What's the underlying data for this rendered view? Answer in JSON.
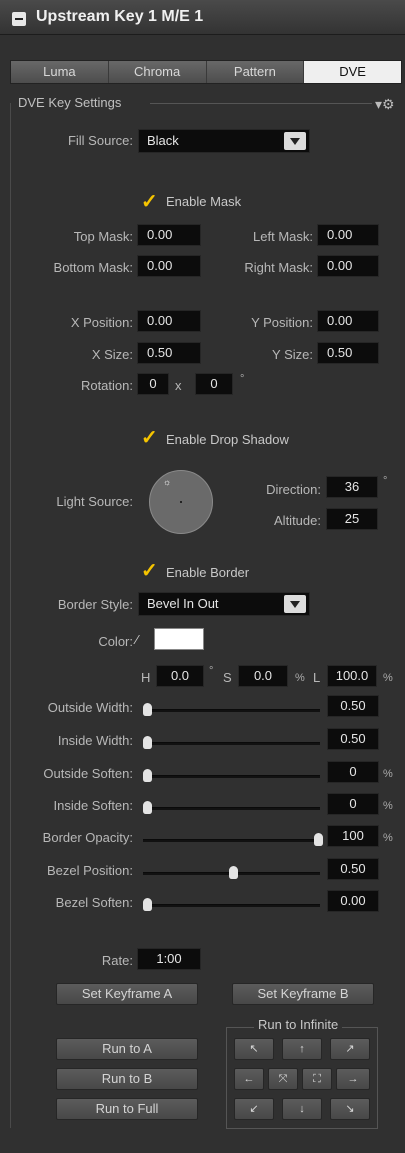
{
  "title": "Upstream Key 1 M/E 1",
  "tabs": [
    "Luma",
    "Chroma",
    "Pattern",
    "DVE"
  ],
  "section": "DVE Key Settings",
  "fill_source": {
    "label": "Fill Source:",
    "value": "Black"
  },
  "enable_mask": "Enable Mask",
  "mask": {
    "top_label": "Top Mask:",
    "top": "0.00",
    "left_label": "Left Mask:",
    "left": "0.00",
    "bottom_label": "Bottom Mask:",
    "bottom": "0.00",
    "right_label": "Right Mask:",
    "right": "0.00"
  },
  "position": {
    "x_pos_label": "X Position:",
    "x_pos": "0.00",
    "y_pos_label": "Y Position:",
    "y_pos": "0.00",
    "x_size_label": "X Size:",
    "x_size": "0.50",
    "y_size_label": "Y Size:",
    "y_size": "0.50",
    "rotation_label": "Rotation:",
    "rotation_a": "0",
    "rotation_sep": "x",
    "rotation_b": "0",
    "rotation_unit": "°"
  },
  "enable_drop_shadow": "Enable Drop Shadow",
  "shadow": {
    "light_source_label": "Light Source:",
    "direction_label": "Direction:",
    "direction": "36",
    "direction_unit": "°",
    "altitude_label": "Altitude:",
    "altitude": "25"
  },
  "enable_border": "Enable Border",
  "border_style": {
    "label": "Border Style:",
    "value": "Bevel In Out"
  },
  "color": {
    "label": "Color:",
    "swatch": "#ffffff",
    "h_label": "H",
    "h": "0.0",
    "h_unit": "°",
    "s_label": "S",
    "s": "0.0",
    "s_unit": "%",
    "l_label": "L",
    "l": "100.0",
    "l_unit": "%"
  },
  "sliders": [
    {
      "label": "Outside Width:",
      "value": "0.50",
      "unit": "",
      "level": 0.0
    },
    {
      "label": "Inside Width:",
      "value": "0.50",
      "unit": "",
      "level": 0.0
    },
    {
      "label": "Outside Soften:",
      "value": "0",
      "unit": "%",
      "level": 0.0
    },
    {
      "label": "Inside Soften:",
      "value": "0",
      "unit": "%",
      "level": 0.0
    },
    {
      "label": "Border Opacity:",
      "value": "100",
      "unit": "%",
      "level": 1.0
    },
    {
      "label": "Bezel Position:",
      "value": "0.50",
      "unit": "",
      "level": 0.5
    },
    {
      "label": "Bezel Soften:",
      "value": "0.00",
      "unit": "",
      "level": 0.0
    }
  ],
  "rate": {
    "label": "Rate:",
    "value": "1:00"
  },
  "buttons": {
    "set_keyframe_a": "Set Keyframe A",
    "set_keyframe_b": "Set Keyframe B",
    "run_to_infinite": "Run to Infinite",
    "run_to_a": "Run to A",
    "run_to_b": "Run to B",
    "run_to_full": "Run to Full"
  },
  "arrows": [
    {
      "name": "arrow-up-left",
      "glyph": "↖"
    },
    {
      "name": "arrow-up",
      "glyph": "↑"
    },
    {
      "name": "arrow-up-right",
      "glyph": "↗"
    },
    {
      "name": "arrow-left",
      "glyph": "←"
    },
    {
      "name": "arrow-center-in",
      "glyph": "⤧"
    },
    {
      "name": "arrow-center-out",
      "glyph": "⛶"
    },
    {
      "name": "arrow-right",
      "glyph": "→"
    },
    {
      "name": "arrow-down-left",
      "glyph": "↙"
    },
    {
      "name": "arrow-down",
      "glyph": "↓"
    },
    {
      "name": "arrow-down-right",
      "glyph": "↘"
    }
  ]
}
